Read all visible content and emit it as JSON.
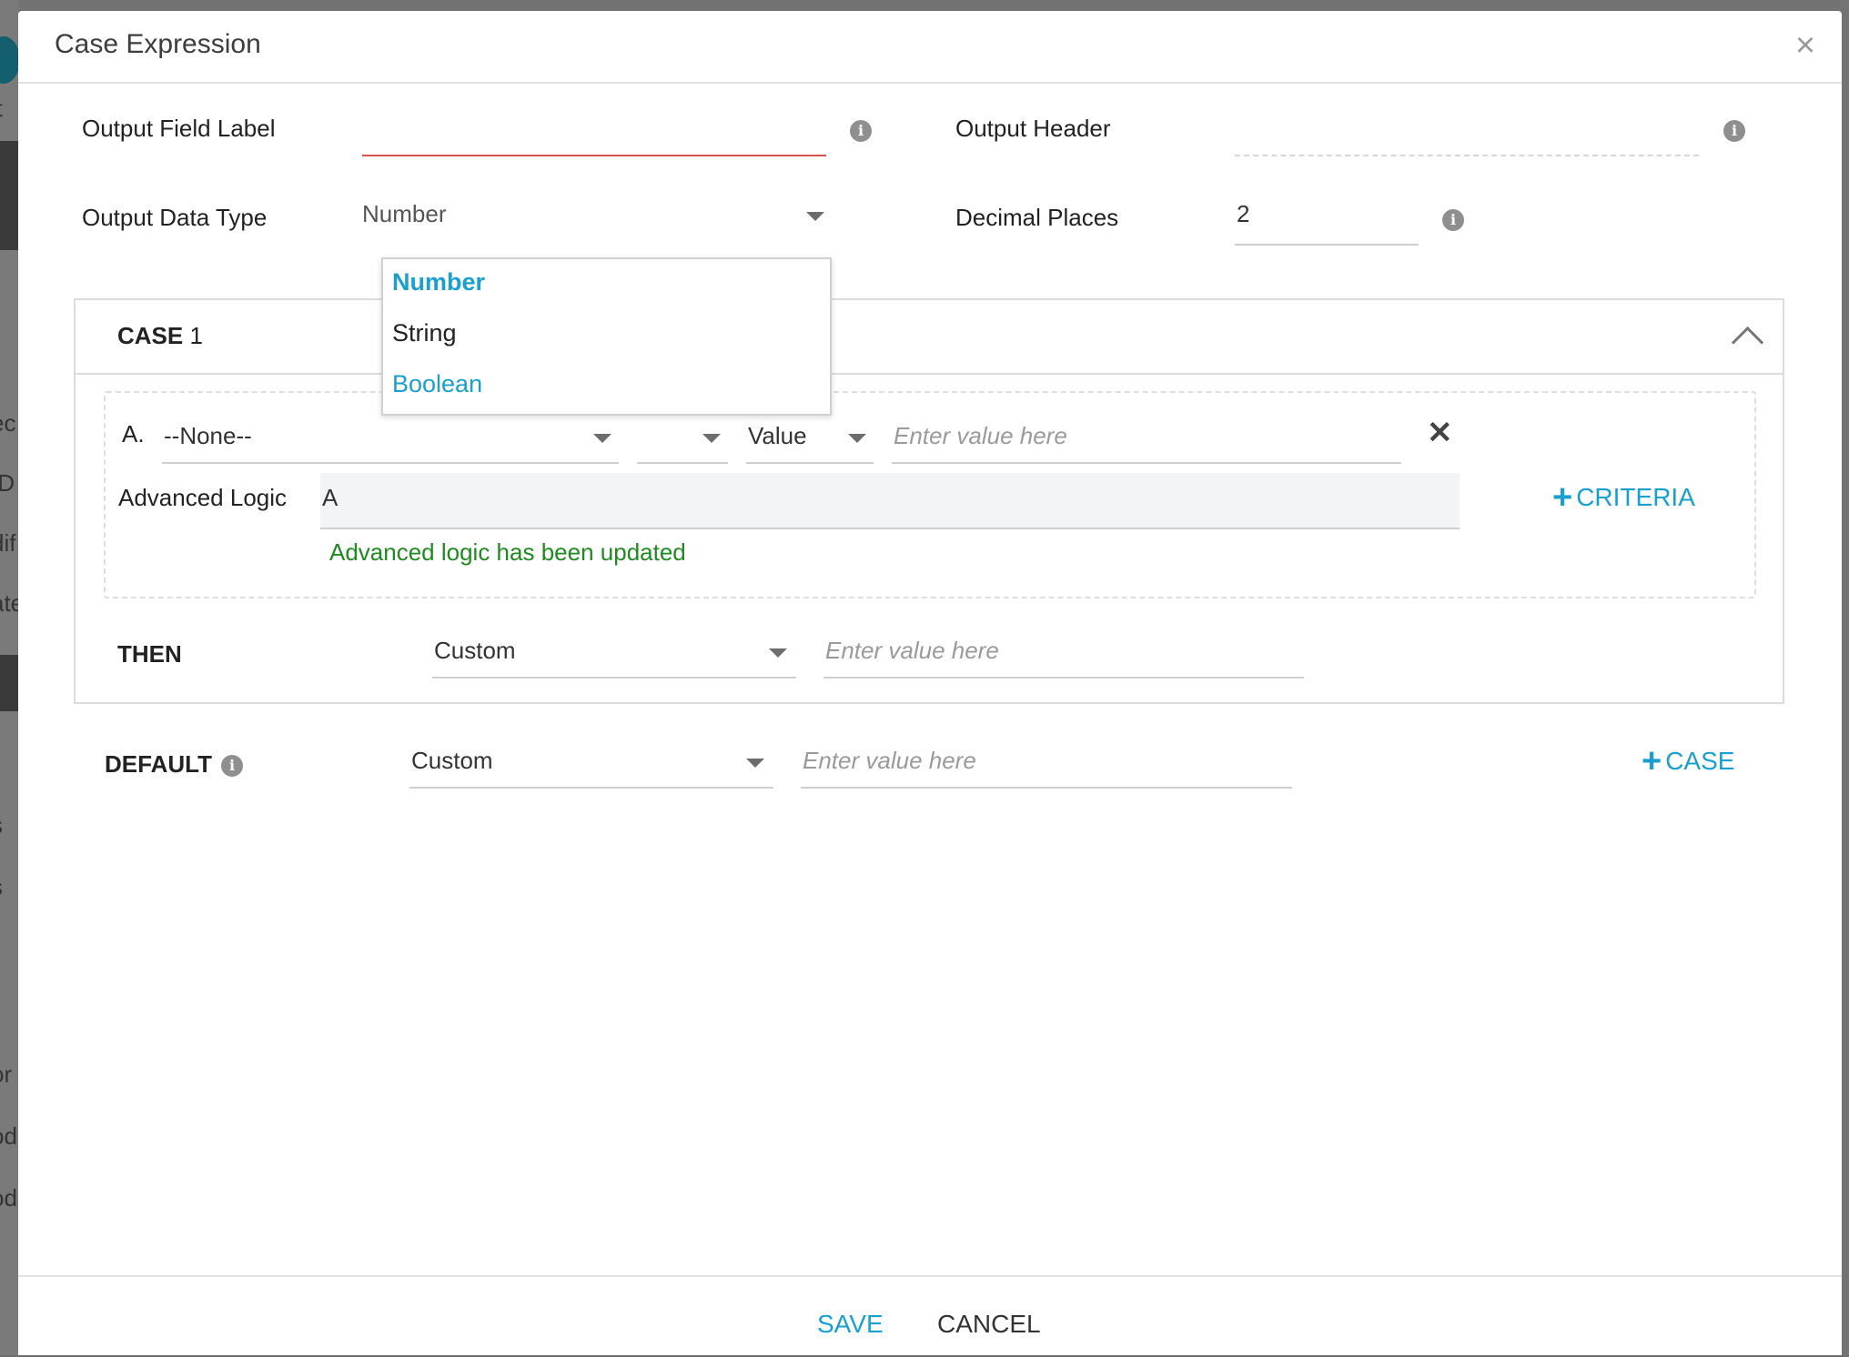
{
  "background_fragments": [
    "it",
    "ec",
    "ID",
    "dif",
    "ate",
    "s",
    "s",
    "or",
    "od",
    "od"
  ],
  "modal": {
    "title": "Case Expression"
  },
  "fields": {
    "output_field_label": {
      "label": "Output Field Label",
      "value": ""
    },
    "output_header": {
      "label": "Output Header",
      "value": ""
    },
    "output_data_type": {
      "label": "Output Data Type",
      "value": "Number"
    },
    "decimal_places": {
      "label": "Decimal Places",
      "value": "2"
    }
  },
  "data_type_options": [
    {
      "label": "Number",
      "state": "selected"
    },
    {
      "label": "String",
      "state": "normal"
    },
    {
      "label": "Boolean",
      "state": "hover"
    }
  ],
  "case": {
    "title_bold": "CASE",
    "title_num": "1",
    "criteria": {
      "letter": "A.",
      "field": "--None--",
      "operator": "",
      "value_type": "Value",
      "value_placeholder": "Enter value here"
    },
    "advanced_logic": {
      "label": "Advanced Logic",
      "value": "A",
      "message": "Advanced logic has been updated"
    },
    "add_criteria": "CRITERIA",
    "then": {
      "label": "THEN",
      "type": "Custom",
      "placeholder": "Enter value here"
    }
  },
  "default": {
    "label": "DEFAULT",
    "type": "Custom",
    "placeholder": "Enter value here",
    "add_case": "CASE"
  },
  "footer": {
    "save": "SAVE",
    "cancel": "CANCEL"
  },
  "colors": {
    "accent": "#1aa0d0",
    "success": "#1f8a1f",
    "error_underline": "#d9534f"
  }
}
